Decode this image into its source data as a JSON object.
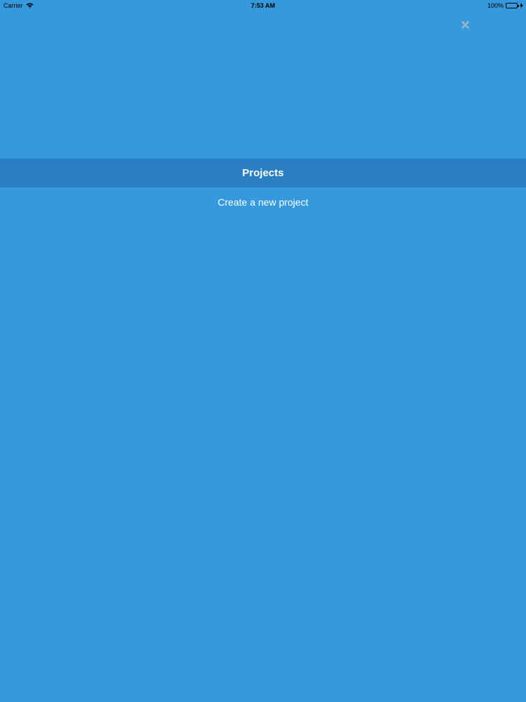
{
  "status_bar": {
    "carrier": "Carrier",
    "time": "7:53 AM",
    "battery": "100%",
    "icons": [
      "wifi-icon",
      "battery-icon",
      "charging-bolt-icon"
    ]
  },
  "close_button": {
    "icon": "close-icon"
  },
  "projects": {
    "header": "Projects",
    "create_label": "Create a new project"
  },
  "colors": {
    "background": "#3799dd",
    "header_background": "#2a7fc2",
    "text": "#ffffff",
    "close_icon": "#9fb4c6",
    "battery_fill": "#4cd964"
  }
}
